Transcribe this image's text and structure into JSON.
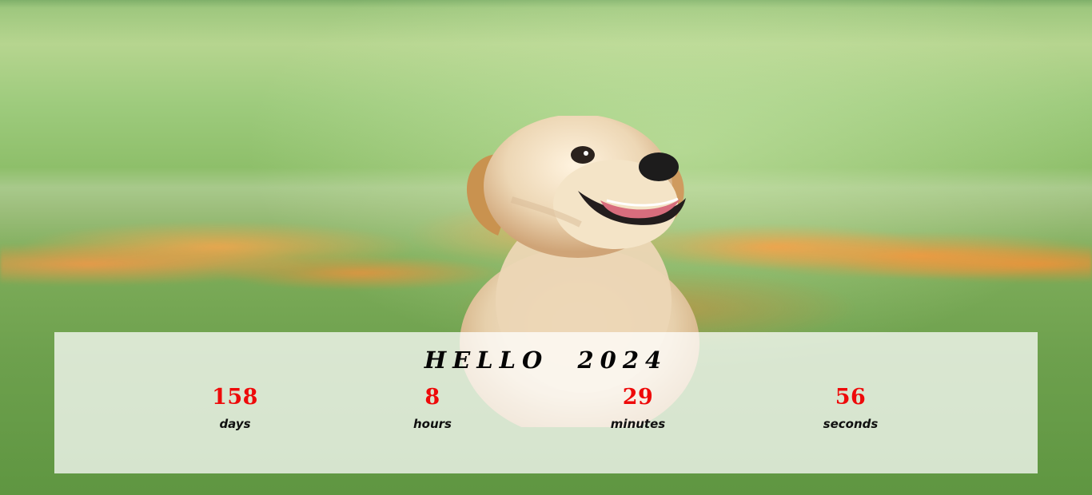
{
  "greeting": {
    "title": "HELLO  2024"
  },
  "countdown": {
    "units": [
      {
        "value": "158",
        "label": "days"
      },
      {
        "value": "8",
        "label": "hours"
      },
      {
        "value": "29",
        "label": "minutes"
      },
      {
        "value": "56",
        "label": "seconds"
      }
    ],
    "value_color": "#ee0a0a"
  },
  "background": {
    "illustration": "golden-retriever-puppy-in-flower-field"
  }
}
